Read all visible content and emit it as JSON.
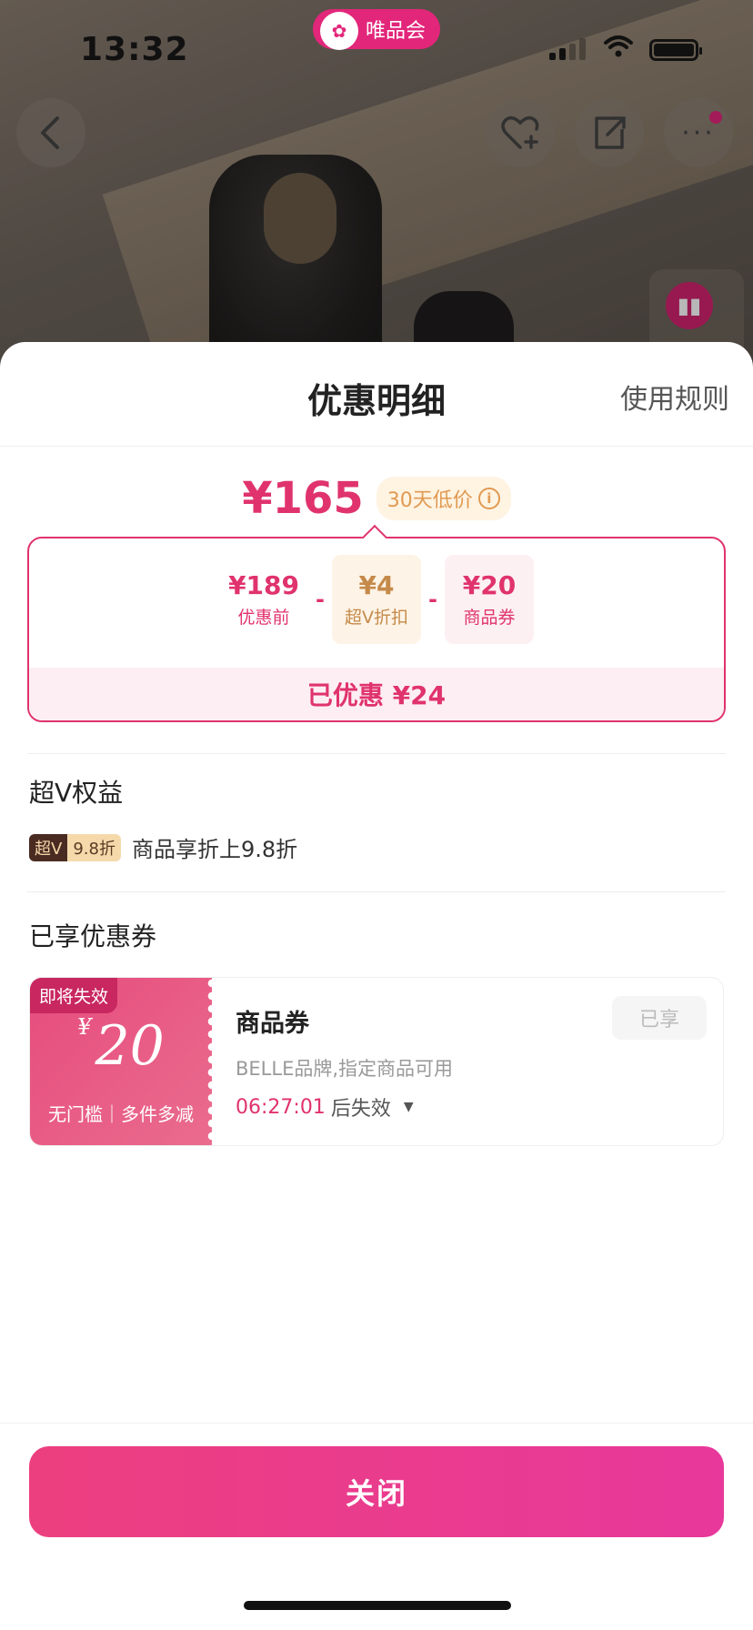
{
  "status": {
    "time": "13:32",
    "brand": "唯品会"
  },
  "sheet": {
    "title": "优惠明细",
    "rules": "使用规则"
  },
  "price": {
    "final": "¥165",
    "low_badge": "30天低价",
    "breakdown": [
      {
        "value": "¥189",
        "label": "优惠前",
        "color": "#e0336e",
        "bg": "#ffffff"
      },
      {
        "value": "¥4",
        "label": "超V折扣",
        "color": "#c58a4a",
        "bg": "#fdf3e6"
      },
      {
        "value": "¥20",
        "label": "商品券",
        "color": "#e0336e",
        "bg": "#fdf0f3"
      }
    ],
    "minus": "-",
    "saved": "已优惠 ¥24"
  },
  "vip": {
    "section_title": "超V权益",
    "tag_a": "超V",
    "tag_b": "9.8折",
    "desc": "商品享折上9.8折"
  },
  "coupons": {
    "section_title": "已享优惠券",
    "item": {
      "expire_tag": "即将失效",
      "currency": "¥",
      "amount": "20",
      "conditions": "无门槛｜多件多减",
      "title": "商品券",
      "desc": "BELLE品牌,指定商品可用",
      "countdown": "06:27:01",
      "countdown_suffix": "后失效",
      "status": "已享"
    }
  },
  "footer": {
    "close": "关闭"
  },
  "colors": {
    "accent": "#e0336e",
    "brand": "#e2267a"
  }
}
